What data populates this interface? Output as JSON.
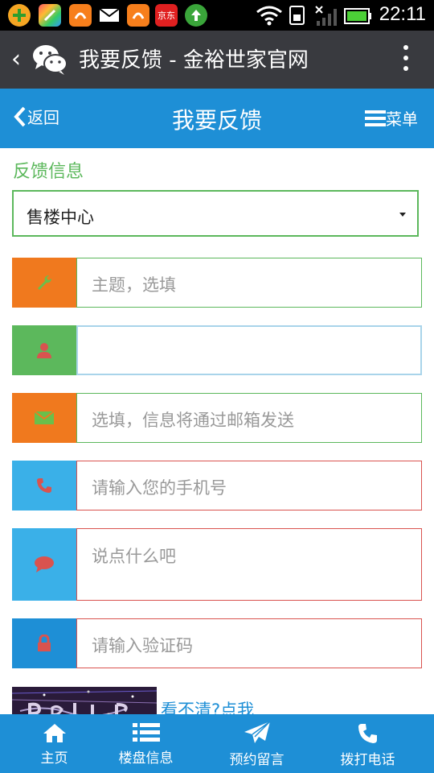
{
  "status_bar": {
    "time": "22:11",
    "app_icons": [
      "add-icon",
      "app-store-icon",
      "uc-browser-icon",
      "mail-icon",
      "uc-browser-icon",
      "jd-icon",
      "upload-icon"
    ],
    "jd_label": "京东"
  },
  "wechat_bar": {
    "back_label": "‹",
    "title": "我要反馈 - 金裕世家官网"
  },
  "header": {
    "back_label": "返回",
    "title": "我要反馈",
    "menu_label": "菜单"
  },
  "form": {
    "section_title": "反馈信息",
    "department_select": "售楼中心",
    "subject_placeholder": "主题，选填",
    "name_value": "",
    "email_placeholder": "选填，信息将通过邮箱发送",
    "phone_placeholder": "请输入您的手机号",
    "message_placeholder": "说点什么吧",
    "captcha_placeholder": "请输入验证码",
    "captcha_refresh_label": "看不清?点我"
  },
  "footer": {
    "tabs": [
      {
        "label": "主页",
        "icon": "home-icon"
      },
      {
        "label": "楼盘信息",
        "icon": "list-icon"
      },
      {
        "label": "预约留言",
        "icon": "send-icon"
      },
      {
        "label": "拨打电话",
        "icon": "phone-icon"
      }
    ]
  },
  "colors": {
    "primary_blue": "#1e8fd6",
    "green": "#5cb85c",
    "orange": "#f0791e",
    "light_blue": "#3ab0e8",
    "red": "#d9534f"
  }
}
